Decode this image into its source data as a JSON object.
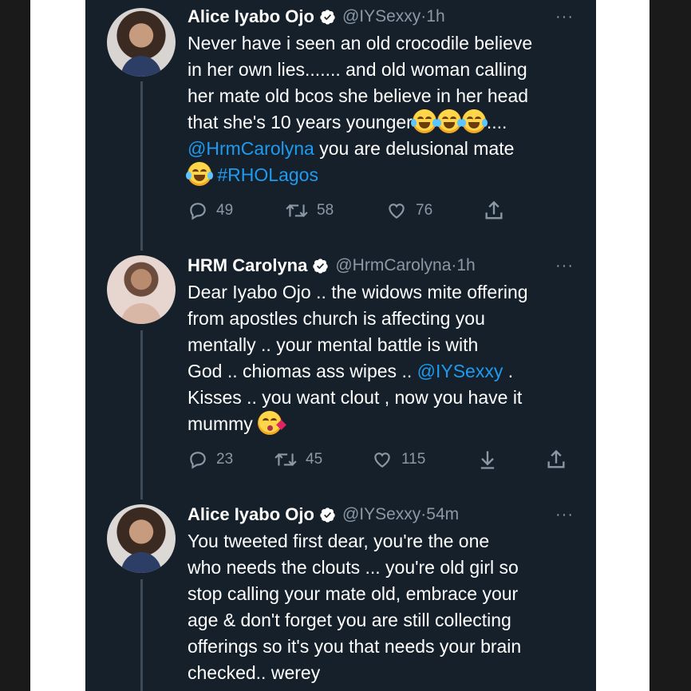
{
  "tweets": [
    {
      "name": "Alice Iyabo Ojo",
      "handle": "@IYSexxy",
      "time": "1h",
      "more": "···",
      "lines": [
        "Never have i seen an old crocodile believe",
        "in her own lies....... and old woman calling",
        "her mate old bcos she believe in her head",
        "that she's 10 years younger",
        "....",
        "@HrmCarolyna",
        " you are delusional mate",
        "#RHOLagos"
      ],
      "replies": "49",
      "retweets": "58",
      "likes": "76"
    },
    {
      "name": "HRM Carolyna",
      "handle": "@HrmCarolyna",
      "time": "1h",
      "more": "···",
      "lines": [
        "Dear Iyabo Ojo .. the widows mite offering",
        "from apostles church is affecting you",
        "mentally .. your mental battle is with",
        "God .. chiomas ass wipes .. ",
        "@IYSexxy",
        " .",
        "Kisses .. you want clout , now you have it",
        "mummy"
      ],
      "replies": "23",
      "retweets": "45",
      "likes": "115"
    },
    {
      "name": "Alice Iyabo Ojo",
      "handle": "@IYSexxy",
      "time": "54m",
      "more": "···",
      "lines": [
        "You tweeted first dear, you're the one",
        "who needs the clouts ... you're old girl so",
        "stop calling your mate old, embrace your",
        "age & don't forget you are still collecting",
        "offerings so it's you that needs your brain",
        "checked.. werey"
      ]
    }
  ],
  "separator": " · ",
  "colors": {
    "background": "#15202b",
    "text": "#ffffff",
    "muted": "#8b98a5",
    "link": "#1d9bf0",
    "verified": "#ffffff"
  },
  "icons": [
    "verified-icon",
    "reply-icon",
    "retweet-icon",
    "like-icon",
    "share-icon",
    "download-icon",
    "more-icon",
    "tears-of-joy-emoji",
    "kissing-heart-emoji"
  ]
}
